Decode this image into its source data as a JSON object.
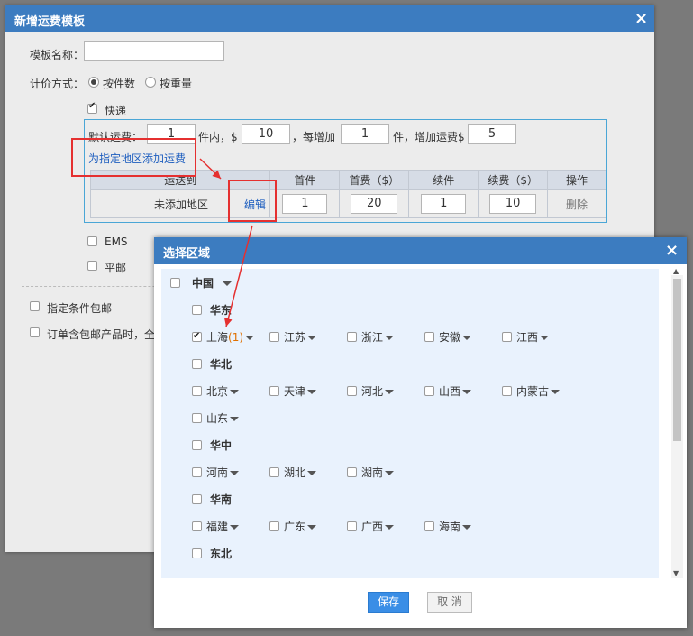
{
  "template_dialog": {
    "title": "新增运费模板",
    "close_icon": "×",
    "template_name_label": "模板名称：",
    "template_name_value": "",
    "pricing_label": "计价方式：",
    "pricing_options": [
      {
        "label": "按件数",
        "selected": true
      },
      {
        "label": "按重量",
        "selected": false
      }
    ],
    "express": {
      "label": "快递",
      "checked": true,
      "default_fee_label": "默认运费：",
      "first_qty": "1",
      "unit_within": "件内，$",
      "first_fee": "10",
      "each_add_label": "，每增加",
      "add_qty": "1",
      "unit_add_fee": "件，增加运费$",
      "add_fee": "5",
      "add_region_link": "为指定地区添加运费",
      "table": {
        "headers": [
          "运送到",
          "首件",
          "首费（$）",
          "续件",
          "续费（$）",
          "操作"
        ],
        "row": {
          "region": "未添加地区",
          "edit": "编辑",
          "first_qty": "1",
          "first_fee": "20",
          "add_qty": "1",
          "add_fee": "10",
          "delete": "删除"
        }
      }
    },
    "ems_label": "EMS",
    "ping_label": "平邮",
    "free_condition_label": "指定条件包邮",
    "order_free_label": "订单含包邮产品时，全"
  },
  "region_dialog": {
    "title": "选择区域",
    "close_icon": "×",
    "country": "中国",
    "groups": [
      {
        "name": "华东",
        "provinces": [
          {
            "name": "上海",
            "checked": true,
            "count": "(1)"
          },
          {
            "name": "江苏"
          },
          {
            "name": "浙江"
          },
          {
            "name": "安徽"
          },
          {
            "name": "江西"
          }
        ]
      },
      {
        "name": "华北",
        "provinces": [
          {
            "name": "北京"
          },
          {
            "name": "天津"
          },
          {
            "name": "河北"
          },
          {
            "name": "山西"
          },
          {
            "name": "内蒙古"
          },
          {
            "name": "山东"
          }
        ]
      },
      {
        "name": "华中",
        "provinces": [
          {
            "name": "河南"
          },
          {
            "name": "湖北"
          },
          {
            "name": "湖南"
          }
        ]
      },
      {
        "name": "华南",
        "provinces": [
          {
            "name": "福建"
          },
          {
            "name": "广东"
          },
          {
            "name": "广西"
          },
          {
            "name": "海南"
          }
        ]
      },
      {
        "name": "东北",
        "provinces": []
      }
    ],
    "save_label": "保存",
    "cancel_label": "取 消"
  },
  "annotation_color": "#e53030",
  "accent_color": "#3c7cc0"
}
